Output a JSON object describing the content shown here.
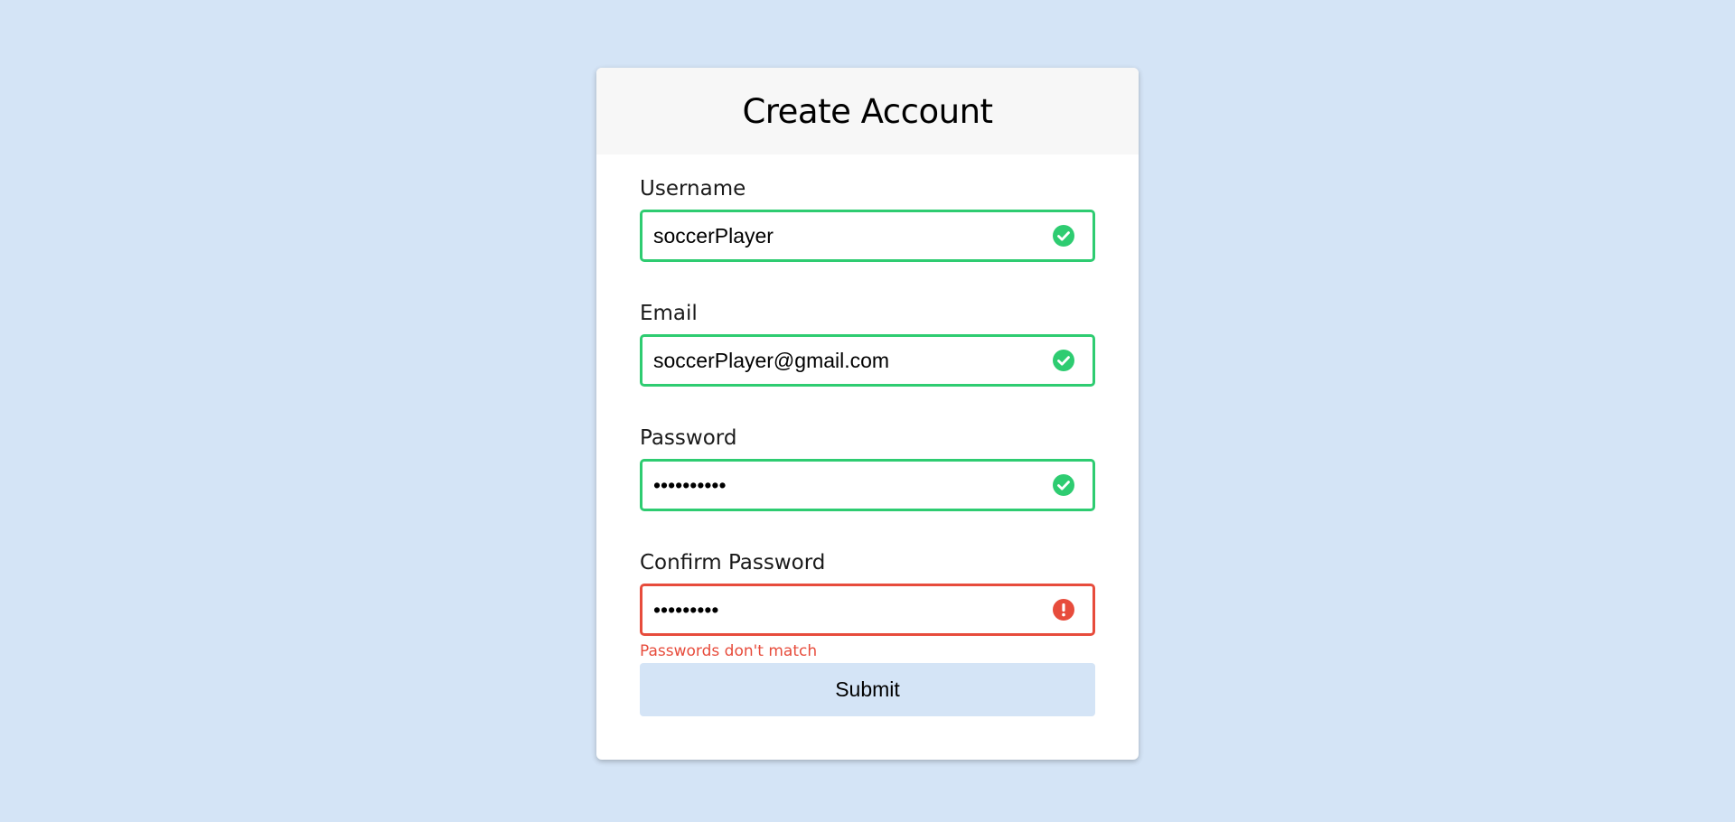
{
  "title": "Create Account",
  "colors": {
    "page_background": "#d4e4f6",
    "header_background": "#f7f7f7",
    "valid": "#2ecc71",
    "invalid": "#e74c3c"
  },
  "fields": {
    "username": {
      "label": "Username",
      "value": "soccerPlayer",
      "status": "valid",
      "status_icon": "check-circle-icon"
    },
    "email": {
      "label": "Email",
      "value": "soccerPlayer@gmail.com",
      "status": "valid",
      "status_icon": "check-circle-icon"
    },
    "password": {
      "label": "Password",
      "value": "••••••••••",
      "status": "valid",
      "status_icon": "check-circle-icon"
    },
    "confirm_password": {
      "label": "Confirm Password",
      "value": "•••••••••",
      "status": "invalid",
      "status_icon": "exclamation-circle-icon",
      "error": "Passwords don't match"
    }
  },
  "submit_label": "Submit"
}
